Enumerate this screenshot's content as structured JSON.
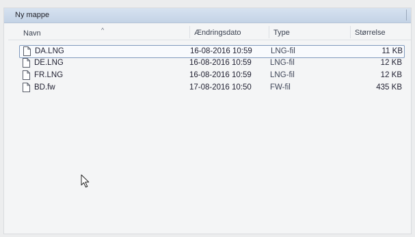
{
  "window": {
    "title": "Ny mappe"
  },
  "columns": {
    "name": "Navn",
    "date": "Ændringsdato",
    "type": "Type",
    "size": "Størrelse"
  },
  "files": [
    {
      "name": "DA.LNG",
      "date": "16-08-2016 10:59",
      "type": "LNG-fil",
      "size": "11 KB",
      "icon": "document-icon",
      "selected": true
    },
    {
      "name": "DE.LNG",
      "date": "16-08-2016 10:59",
      "type": "LNG-fil",
      "size": "12 KB",
      "icon": "document-icon",
      "selected": false
    },
    {
      "name": "FR.LNG",
      "date": "16-08-2016 10:59",
      "type": "LNG-fil",
      "size": "12 KB",
      "icon": "document-icon",
      "selected": false
    },
    {
      "name": "BD.fw",
      "date": "17-08-2016 10:50",
      "type": "FW-fil",
      "size": "435 KB",
      "icon": "document-icon",
      "selected": false
    }
  ],
  "colors": {
    "titlebar": "#c4d3e6",
    "selection_border": "#7f99bd"
  }
}
